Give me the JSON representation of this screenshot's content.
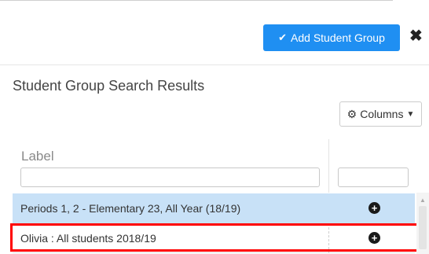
{
  "header": {
    "add_button_icon": "check-icon",
    "add_button_label": "Add Student Group",
    "close_icon": "close-icon",
    "accent_color": "#1f8ff2"
  },
  "results": {
    "title": "Student Group Search Results",
    "columns_button_icon": "gear-icon",
    "columns_button_label": "Columns",
    "columns": [
      {
        "label": "Label",
        "filter_value": ""
      },
      {
        "label": "",
        "filter_value": ""
      }
    ],
    "rows": [
      {
        "label": "Periods 1, 2 - Elementary 23, All Year (18/19)",
        "action_icon": "plus-circle-icon",
        "selected": true
      },
      {
        "label": "Olivia : All students 2018/19",
        "action_icon": "plus-circle-icon",
        "highlighted": true
      }
    ],
    "selected_row_color": "#c8e1f7",
    "highlight_color": "#ff0000"
  }
}
